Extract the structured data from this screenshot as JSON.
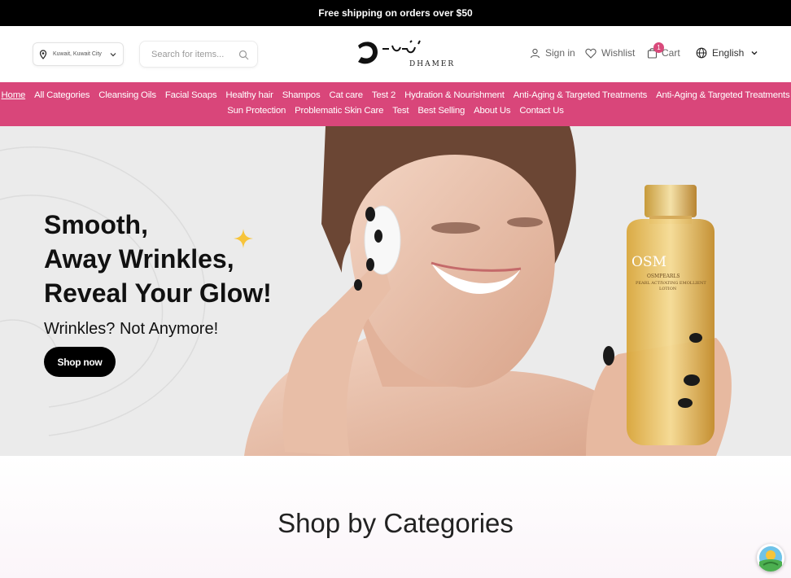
{
  "topbar": {
    "text": "Free shipping on orders over $50"
  },
  "header": {
    "location": "Kuwait, Kuwait City",
    "search_placeholder": "Search for items...",
    "brand_name": "DHAMER",
    "sign_in": "Sign in",
    "wishlist": "Wishlist",
    "cart": "Cart",
    "cart_count": "1",
    "language": "English"
  },
  "menu": {
    "row1": [
      "Home",
      "All Categories",
      "Cleansing Oils",
      "Facial Soaps",
      "Healthy hair",
      "Shampos",
      "Cat care",
      "Test 2",
      "Hydration & Nourishment",
      "Anti-Aging & Targeted Treatments",
      "Anti-Aging & Targeted Treatments"
    ],
    "row2": [
      "Sun Protection",
      "Problematic Skin Care",
      "Test",
      "Best Selling",
      "About Us",
      "Contact Us"
    ]
  },
  "hero": {
    "line1": "Smooth,",
    "line2": "Away Wrinkles,",
    "line3": "Reveal Your Glow!",
    "subtitle": "Wrinkles? Not Anymore!",
    "cta": "Shop now",
    "bottle_brand": "OSM",
    "bottle_text1": "OSMPEARLS",
    "bottle_text2": "PEARL ACTIVATING EMOLLIENT",
    "bottle_text3": "LOTION"
  },
  "section": {
    "title": "Shop by Categories"
  },
  "colors": {
    "accent": "#d9467a",
    "topbar": "#000000"
  }
}
